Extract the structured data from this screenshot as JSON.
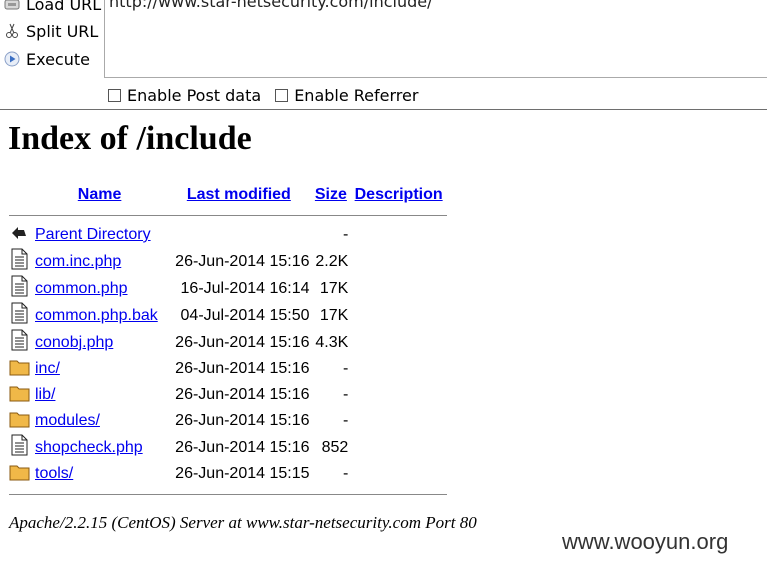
{
  "toolbar": {
    "actions": [
      {
        "label": "Load URL",
        "icon": "load-url-icon"
      },
      {
        "label": "Split URL",
        "icon": "scissors-icon"
      },
      {
        "label": "Execute",
        "icon": "play-icon"
      }
    ],
    "url": "http://www.star-netsecurity.com/include/",
    "options": [
      {
        "label": "Enable Post data",
        "checked": false
      },
      {
        "label": "Enable Referrer",
        "checked": false
      }
    ]
  },
  "index": {
    "title": "Index of /include",
    "headers": {
      "name": "Name",
      "modified": "Last modified",
      "size": "Size",
      "description": "Description"
    },
    "entries": [
      {
        "icon": "back-arrow-icon",
        "name": "Parent Directory",
        "modified": "",
        "size": "-"
      },
      {
        "icon": "file-icon",
        "name": "com.inc.php",
        "modified": "26-Jun-2014 15:16",
        "size": "2.2K"
      },
      {
        "icon": "file-icon",
        "name": "common.php",
        "modified": "16-Jul-2014 16:14",
        "size": "17K"
      },
      {
        "icon": "file-icon",
        "name": "common.php.bak",
        "modified": "04-Jul-2014 15:50",
        "size": "17K"
      },
      {
        "icon": "file-icon",
        "name": "conobj.php",
        "modified": "26-Jun-2014 15:16",
        "size": "4.3K"
      },
      {
        "icon": "folder-icon",
        "name": "inc/",
        "modified": "26-Jun-2014 15:16",
        "size": "-"
      },
      {
        "icon": "folder-icon",
        "name": "lib/",
        "modified": "26-Jun-2014 15:16",
        "size": "-"
      },
      {
        "icon": "folder-icon",
        "name": "modules/",
        "modified": "26-Jun-2014 15:16",
        "size": "-"
      },
      {
        "icon": "file-icon",
        "name": "shopcheck.php",
        "modified": "26-Jun-2014 15:16",
        "size": "852"
      },
      {
        "icon": "folder-icon",
        "name": "tools/",
        "modified": "26-Jun-2014 15:15",
        "size": "-"
      }
    ],
    "footer": "Apache/2.2.15 (CentOS) Server at www.star-netsecurity.com Port 80"
  },
  "watermark": "www.wooyun.org",
  "colors": {
    "link": "#0000ee",
    "folder": "#f0b848",
    "divider": "#888888"
  }
}
